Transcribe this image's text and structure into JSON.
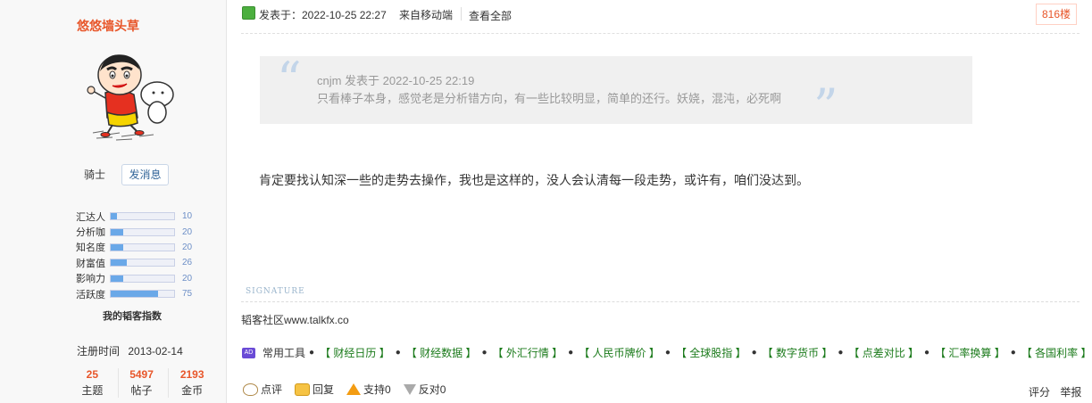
{
  "sidebar": {
    "username": "悠悠墙头草",
    "rank": "骑士",
    "pm_button": "发消息",
    "stats": [
      {
        "label": "汇达人",
        "value": "10",
        "fill": 0.1
      },
      {
        "label": "分析咖",
        "value": "20",
        "fill": 0.2
      },
      {
        "label": "知名度",
        "value": "20",
        "fill": 0.2
      },
      {
        "label": "财富值",
        "value": "26",
        "fill": 0.26
      },
      {
        "label": "影响力",
        "value": "20",
        "fill": 0.2
      },
      {
        "label": "活跃度",
        "value": "75",
        "fill": 0.75
      }
    ],
    "index_title": "我的韬客指数",
    "reg_label": "注册时间",
    "reg_date": "2013-02-14",
    "counts": [
      {
        "num": "25",
        "label": "主题"
      },
      {
        "num": "5497",
        "label": "帖子"
      },
      {
        "num": "2193",
        "label": "金币"
      }
    ]
  },
  "post": {
    "posted_at": "发表于：2022-10-25 22:27",
    "from": "来自移动端",
    "view_all": "查看全部",
    "floor": "816楼",
    "quote_head": "cnjm 发表于 2022-10-25 22:19",
    "quote_text": "只看棒子本身，感觉老是分析错方向，有一些比较明显，简单的还行。妖娆，混沌，必死啊",
    "body": "肯定要找认知深一些的走势去操作，我也是这样的，没人会认清每一段走势，或许有，咱们没达到。"
  },
  "signature": {
    "label": "SIGNATURE",
    "text": "韬客社区www.talkfx.co"
  },
  "tools": {
    "badge": "AD",
    "label": "常用工具",
    "items": [
      "【 财经日历 】",
      "【 财经数据 】",
      "【 外汇行情 】",
      "【 人民币牌价 】",
      "【 全球股指 】",
      "【 数字货币 】",
      "【 点差对比 】",
      "【 汇率换算 】",
      "【 各国利率 】"
    ]
  },
  "actions": {
    "comment": "点评",
    "reply": "回复",
    "support": "支持0",
    "oppose": "反对0",
    "rate": "评分",
    "report": "举报"
  },
  "colors": {
    "username": "#e8562a",
    "stat_fill": "#6aa8e8",
    "tool_link": "#1a7a1a"
  }
}
